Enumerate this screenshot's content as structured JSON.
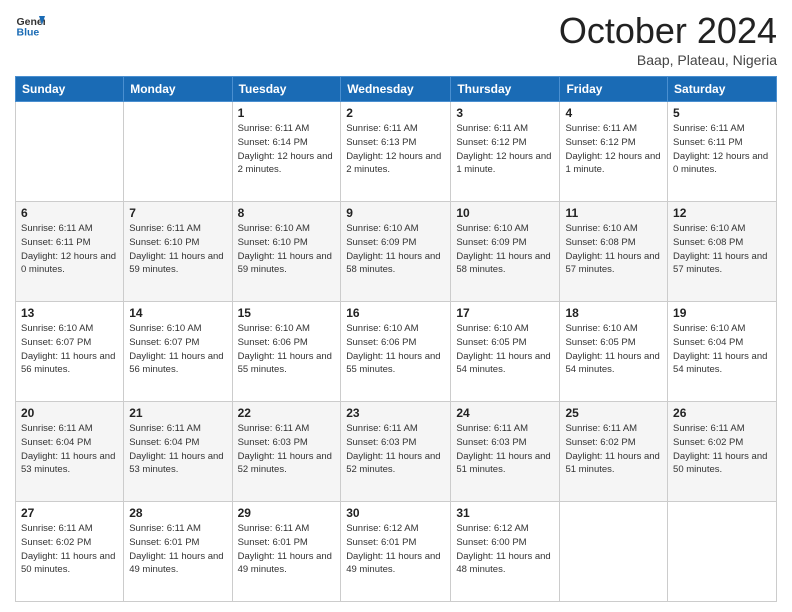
{
  "logo": {
    "general": "General",
    "blue": "Blue"
  },
  "title": "October 2024",
  "subtitle": "Baap, Plateau, Nigeria",
  "days": [
    "Sunday",
    "Monday",
    "Tuesday",
    "Wednesday",
    "Thursday",
    "Friday",
    "Saturday"
  ],
  "weeks": [
    [
      {
        "day": "",
        "info": ""
      },
      {
        "day": "",
        "info": ""
      },
      {
        "day": "1",
        "info": "Sunrise: 6:11 AM\nSunset: 6:14 PM\nDaylight: 12 hours and 2 minutes."
      },
      {
        "day": "2",
        "info": "Sunrise: 6:11 AM\nSunset: 6:13 PM\nDaylight: 12 hours and 2 minutes."
      },
      {
        "day": "3",
        "info": "Sunrise: 6:11 AM\nSunset: 6:12 PM\nDaylight: 12 hours and 1 minute."
      },
      {
        "day": "4",
        "info": "Sunrise: 6:11 AM\nSunset: 6:12 PM\nDaylight: 12 hours and 1 minute."
      },
      {
        "day": "5",
        "info": "Sunrise: 6:11 AM\nSunset: 6:11 PM\nDaylight: 12 hours and 0 minutes."
      }
    ],
    [
      {
        "day": "6",
        "info": "Sunrise: 6:11 AM\nSunset: 6:11 PM\nDaylight: 12 hours and 0 minutes."
      },
      {
        "day": "7",
        "info": "Sunrise: 6:11 AM\nSunset: 6:10 PM\nDaylight: 11 hours and 59 minutes."
      },
      {
        "day": "8",
        "info": "Sunrise: 6:10 AM\nSunset: 6:10 PM\nDaylight: 11 hours and 59 minutes."
      },
      {
        "day": "9",
        "info": "Sunrise: 6:10 AM\nSunset: 6:09 PM\nDaylight: 11 hours and 58 minutes."
      },
      {
        "day": "10",
        "info": "Sunrise: 6:10 AM\nSunset: 6:09 PM\nDaylight: 11 hours and 58 minutes."
      },
      {
        "day": "11",
        "info": "Sunrise: 6:10 AM\nSunset: 6:08 PM\nDaylight: 11 hours and 57 minutes."
      },
      {
        "day": "12",
        "info": "Sunrise: 6:10 AM\nSunset: 6:08 PM\nDaylight: 11 hours and 57 minutes."
      }
    ],
    [
      {
        "day": "13",
        "info": "Sunrise: 6:10 AM\nSunset: 6:07 PM\nDaylight: 11 hours and 56 minutes."
      },
      {
        "day": "14",
        "info": "Sunrise: 6:10 AM\nSunset: 6:07 PM\nDaylight: 11 hours and 56 minutes."
      },
      {
        "day": "15",
        "info": "Sunrise: 6:10 AM\nSunset: 6:06 PM\nDaylight: 11 hours and 55 minutes."
      },
      {
        "day": "16",
        "info": "Sunrise: 6:10 AM\nSunset: 6:06 PM\nDaylight: 11 hours and 55 minutes."
      },
      {
        "day": "17",
        "info": "Sunrise: 6:10 AM\nSunset: 6:05 PM\nDaylight: 11 hours and 54 minutes."
      },
      {
        "day": "18",
        "info": "Sunrise: 6:10 AM\nSunset: 6:05 PM\nDaylight: 11 hours and 54 minutes."
      },
      {
        "day": "19",
        "info": "Sunrise: 6:10 AM\nSunset: 6:04 PM\nDaylight: 11 hours and 54 minutes."
      }
    ],
    [
      {
        "day": "20",
        "info": "Sunrise: 6:11 AM\nSunset: 6:04 PM\nDaylight: 11 hours and 53 minutes."
      },
      {
        "day": "21",
        "info": "Sunrise: 6:11 AM\nSunset: 6:04 PM\nDaylight: 11 hours and 53 minutes."
      },
      {
        "day": "22",
        "info": "Sunrise: 6:11 AM\nSunset: 6:03 PM\nDaylight: 11 hours and 52 minutes."
      },
      {
        "day": "23",
        "info": "Sunrise: 6:11 AM\nSunset: 6:03 PM\nDaylight: 11 hours and 52 minutes."
      },
      {
        "day": "24",
        "info": "Sunrise: 6:11 AM\nSunset: 6:03 PM\nDaylight: 11 hours and 51 minutes."
      },
      {
        "day": "25",
        "info": "Sunrise: 6:11 AM\nSunset: 6:02 PM\nDaylight: 11 hours and 51 minutes."
      },
      {
        "day": "26",
        "info": "Sunrise: 6:11 AM\nSunset: 6:02 PM\nDaylight: 11 hours and 50 minutes."
      }
    ],
    [
      {
        "day": "27",
        "info": "Sunrise: 6:11 AM\nSunset: 6:02 PM\nDaylight: 11 hours and 50 minutes."
      },
      {
        "day": "28",
        "info": "Sunrise: 6:11 AM\nSunset: 6:01 PM\nDaylight: 11 hours and 49 minutes."
      },
      {
        "day": "29",
        "info": "Sunrise: 6:11 AM\nSunset: 6:01 PM\nDaylight: 11 hours and 49 minutes."
      },
      {
        "day": "30",
        "info": "Sunrise: 6:12 AM\nSunset: 6:01 PM\nDaylight: 11 hours and 49 minutes."
      },
      {
        "day": "31",
        "info": "Sunrise: 6:12 AM\nSunset: 6:00 PM\nDaylight: 11 hours and 48 minutes."
      },
      {
        "day": "",
        "info": ""
      },
      {
        "day": "",
        "info": ""
      }
    ]
  ]
}
